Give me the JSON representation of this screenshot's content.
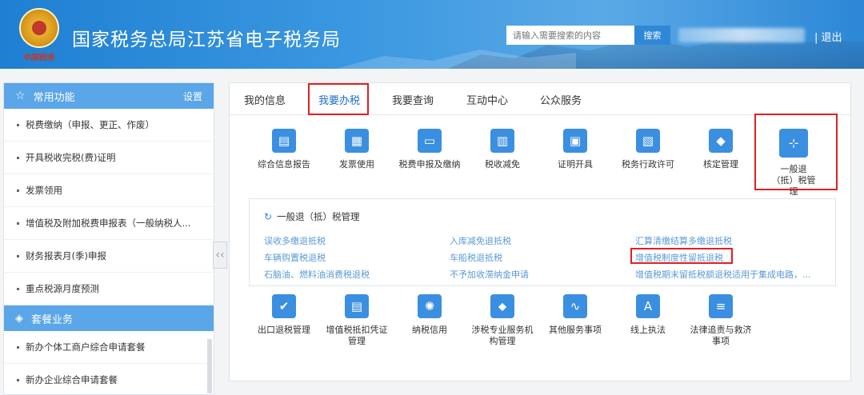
{
  "header": {
    "emblem_text": "中国税务",
    "site_title": "国家税务总局江苏省电子税务局",
    "search_placeholder": "请输入需要搜索的内容",
    "search_button": "搜索",
    "logout_label": "| 退出"
  },
  "sidebar": {
    "common_title": "常用功能",
    "settings_label": "设置",
    "common_items": [
      "税费缴纳（申报、更正、作废）",
      "开具税收完税(费)证明",
      "发票领用",
      "增值税及附加税费申报表（一般纳税人...",
      "财务报表月(季)申报",
      "重点税源月度预测"
    ],
    "package_title": "套餐业务",
    "package_items": [
      "新办个体工商户综合申请套餐",
      "新办企业综合申请套餐"
    ],
    "collapse_glyph": "‹‹"
  },
  "main": {
    "tabs": [
      "我的信息",
      "我要办税",
      "我要查询",
      "互动中心",
      "公众服务"
    ],
    "active_tab": "我要办税",
    "top_icons": [
      {
        "label": "综合信息报告",
        "icon": "monitor-chart-icon",
        "color": "#3b8fe0"
      },
      {
        "label": "发票使用",
        "icon": "document-icon",
        "color": "#3b8fe0"
      },
      {
        "label": "税费申报及缴纳",
        "icon": "monitor-icon",
        "color": "#3b8fe0"
      },
      {
        "label": "税收减免",
        "icon": "chart-doc-icon",
        "color": "#3b8fe0"
      },
      {
        "label": "证明开具",
        "icon": "certificate-icon",
        "color": "#3b8fe0"
      },
      {
        "label": "税务行政许可",
        "icon": "license-icon",
        "color": "#3b8fe0"
      },
      {
        "label": "核定管理",
        "icon": "shield-icon",
        "color": "#3b8fe0"
      },
      {
        "label": "一般退（抵）税管理",
        "icon": "org-chart-icon",
        "color": "#3b8fe0"
      }
    ],
    "sub_panel": {
      "title": "一般退（抵）税管理",
      "links_col1": [
        "误收多缴退抵税",
        "车辆购置税退税",
        "石脑油、燃料油消费税退税"
      ],
      "links_col2": [
        "入库减免退抵税",
        "车船税退抵税",
        "不予加收滞纳金申请"
      ],
      "links_col3": [
        "汇算清缴结算多缴退抵税",
        "增值税制度性留抵退税",
        "增值税期末留抵税额退税适用于集成电路，..."
      ]
    },
    "bottom_icons": [
      {
        "label": "出口退税管理",
        "icon": "shield-check-icon",
        "color": "#3b8fe0"
      },
      {
        "label": "增值税抵扣凭证管理",
        "icon": "document-lock-icon",
        "color": "#3b8fe0"
      },
      {
        "label": "纳税信用",
        "icon": "bulb-icon",
        "color": "#3b8fe0"
      },
      {
        "label": "涉税专业服务机构管理",
        "icon": "tag-icon",
        "color": "#3b8fe0"
      },
      {
        "label": "其他服务事项",
        "icon": "monitor-wave-icon",
        "color": "#3b8fe0"
      },
      {
        "label": "线上执法",
        "icon": "translate-icon",
        "color": "#3b8fe0"
      },
      {
        "label": "法律追责与救济事项",
        "icon": "document-list-icon",
        "color": "#3b8fe0"
      }
    ]
  }
}
